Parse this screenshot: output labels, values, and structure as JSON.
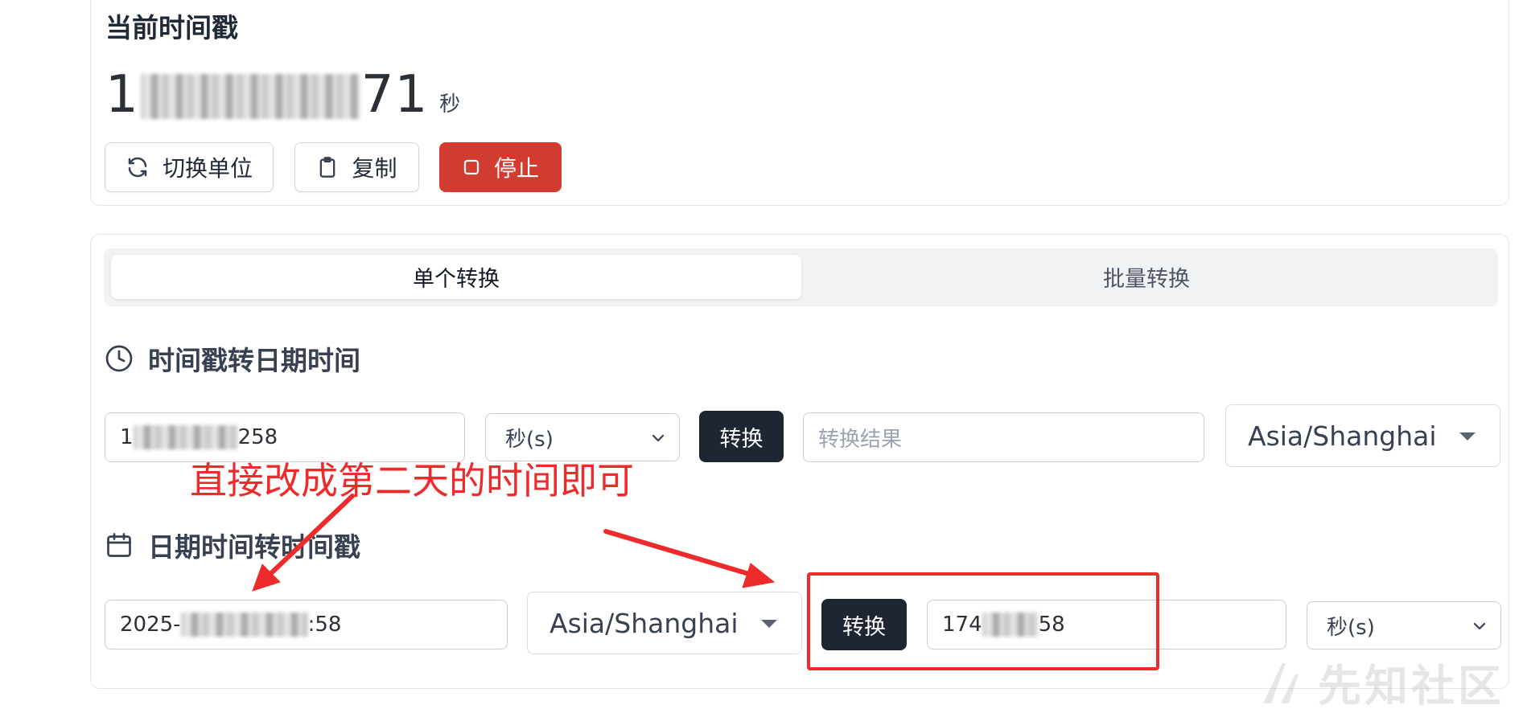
{
  "current": {
    "title": "当前时间戳",
    "timestamp_prefix": "1",
    "timestamp_suffix": "71",
    "unit_label": "秒"
  },
  "buttons": {
    "switch_unit": "切换单位",
    "copy": "复制",
    "stop": "停止"
  },
  "tabs": [
    {
      "label": "单个转换",
      "active": true
    },
    {
      "label": "批量转换",
      "active": false
    }
  ],
  "ts_to_date": {
    "title": "时间戳转日期时间",
    "input_prefix": "1",
    "input_suffix": "258",
    "unit": "秒(s)",
    "convert": "转换",
    "result_placeholder": "转换结果",
    "timezone": "Asia/Shanghai"
  },
  "date_to_ts": {
    "title": "日期时间转时间戳",
    "input_prefix": "2025-",
    "input_suffix": ":58",
    "timezone": "Asia/Shanghai",
    "convert": "转换",
    "output_prefix": "174",
    "output_suffix": "58",
    "unit": "秒(s)"
  },
  "annotation": {
    "text": "直接改成第二天的时间即可",
    "color": "#ef2a2a"
  },
  "watermark": "先知社区",
  "colors": {
    "stop_button": "#d13b30",
    "dark_button": "#1e2634",
    "annotation": "#ef2a2a"
  },
  "icons": {
    "switch_unit": "refresh-icon",
    "copy": "clipboard-icon",
    "stop": "stop-square-icon",
    "ts_to_date": "clock-icon",
    "date_to_ts": "calendar-icon",
    "select": "chevron-down-icon"
  }
}
